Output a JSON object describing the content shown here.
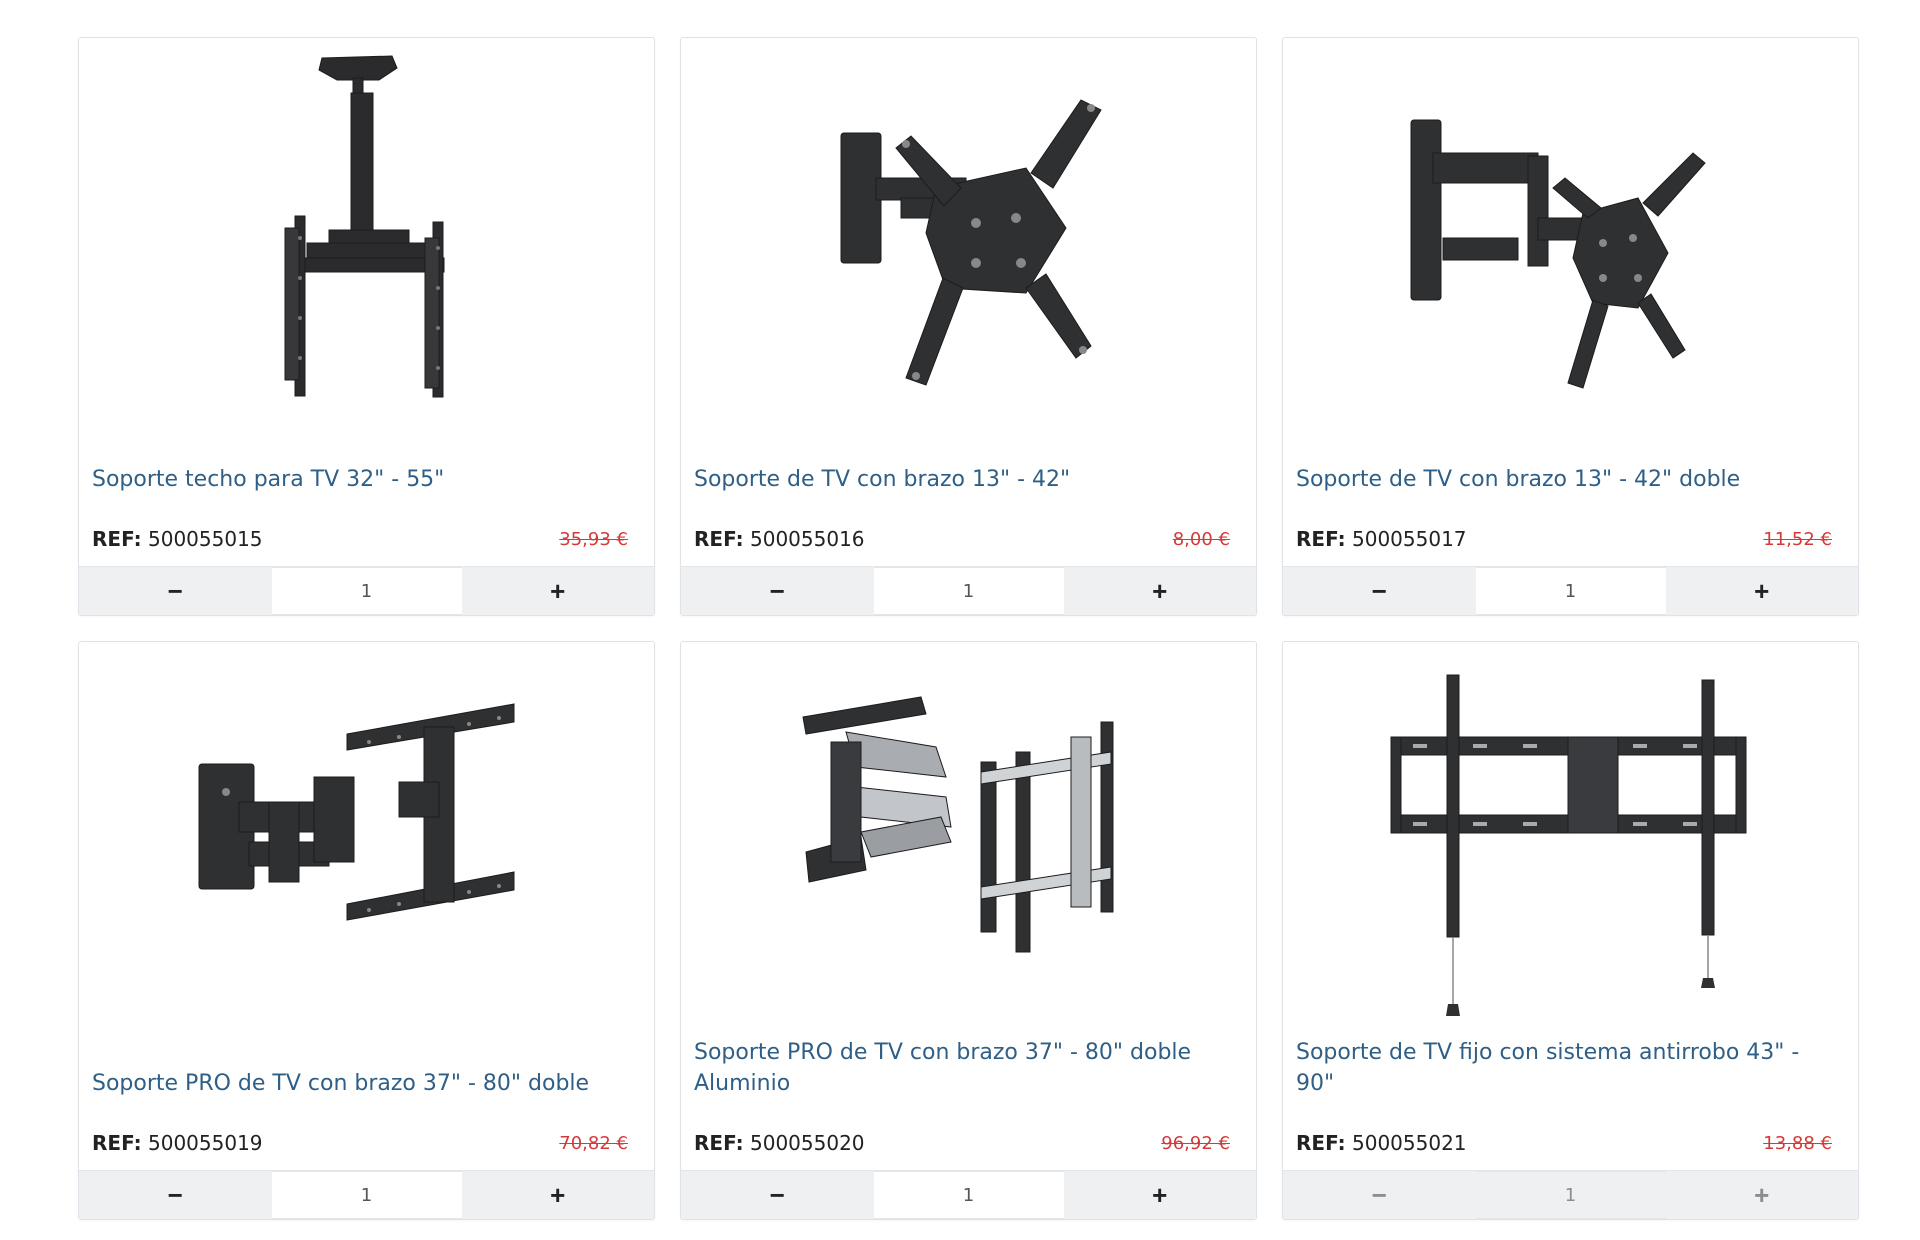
{
  "products": [
    {
      "title": "Soporte techo para TV 32\" - 55\"",
      "ref_label": "REF:",
      "ref": "500055015",
      "old_price": "35,93 €",
      "qty": "1",
      "minus": "−",
      "plus": "+",
      "icon": "ceiling-tv-mount-icon"
    },
    {
      "title": "Soporte de TV con brazo 13\" - 42\"",
      "ref_label": "REF:",
      "ref": "500055016",
      "old_price": "8,00 €",
      "qty": "1",
      "minus": "−",
      "plus": "+",
      "icon": "arm-tv-mount-icon"
    },
    {
      "title": "Soporte de TV con brazo 13\" - 42\" doble",
      "ref_label": "REF:",
      "ref": "500055017",
      "old_price": "11,52 €",
      "qty": "1",
      "minus": "−",
      "plus": "+",
      "icon": "double-arm-tv-mount-icon"
    },
    {
      "title": "Soporte PRO de TV con brazo 37\" - 80\" doble",
      "ref_label": "REF:",
      "ref": "500055019",
      "old_price": "70,82 €",
      "qty": "1",
      "minus": "−",
      "plus": "+",
      "icon": "pro-double-arm-tv-mount-icon"
    },
    {
      "title": "Soporte PRO de TV con brazo 37\" - 80\" doble Aluminio",
      "ref_label": "REF:",
      "ref": "500055020",
      "old_price": "96,92 €",
      "qty": "1",
      "minus": "−",
      "plus": "+",
      "icon": "pro-aluminium-arm-tv-mount-icon"
    },
    {
      "title": "Soporte de TV fijo con sistema antirrobo 43\" - 90\"",
      "ref_label": "REF:",
      "ref": "500055021",
      "old_price": "13,88 €",
      "qty": "1",
      "minus": "−",
      "plus": "+",
      "icon": "fixed-antitheft-tv-mount-icon"
    }
  ],
  "colors": {
    "title": "#2f5f86",
    "old_price": "#d53a3a",
    "qty_bar": "#eef0f2"
  }
}
